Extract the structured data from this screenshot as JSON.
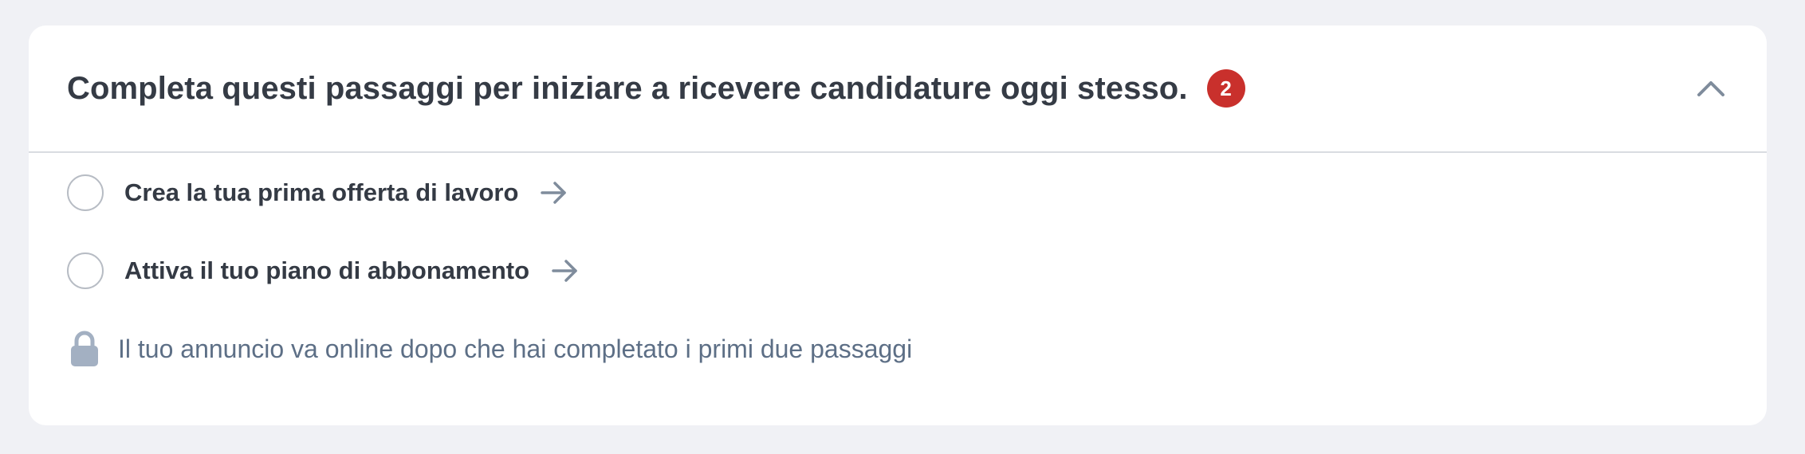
{
  "header": {
    "title": "Completa questi passaggi per iniziare a ricevere candidature oggi stesso.",
    "badge_count": "2",
    "toggle_icon": "chevron-up-icon"
  },
  "steps": [
    {
      "label": "Crea la tua prima offerta di lavoro",
      "completed": false,
      "icon": "arrow-right-icon"
    },
    {
      "label": "Attiva il tuo piano di abbonamento",
      "completed": false,
      "icon": "arrow-right-icon"
    }
  ],
  "notice": {
    "icon": "lock-icon",
    "text": "Il tuo annuncio va online dopo che hai completato i primi due passaggi"
  },
  "colors": {
    "page_background": "#f0f1f5",
    "card_background": "#ffffff",
    "badge": "#c9302c",
    "title_text": "#353b45",
    "muted_text": "#5d6f86",
    "icon_gray": "#7f8c9c",
    "lock_gray": "#a3b0c2"
  }
}
